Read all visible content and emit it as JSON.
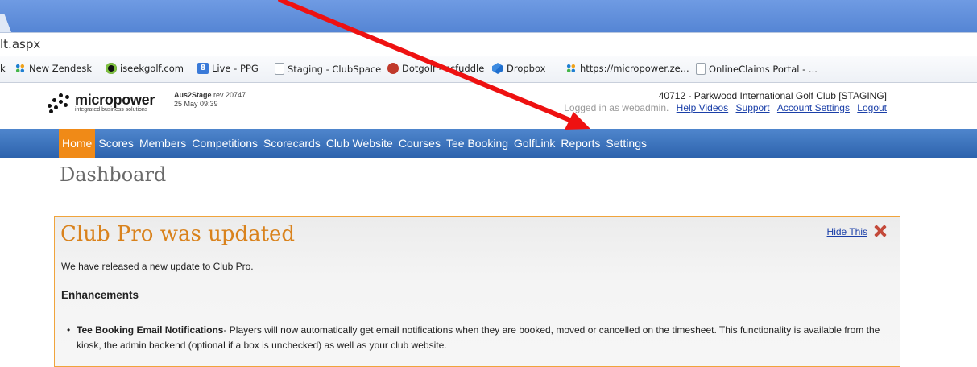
{
  "browser": {
    "url_partial": "lt.aspx",
    "bookmarks": [
      {
        "label": "k",
        "icon": "none"
      },
      {
        "label": "New Zendesk",
        "icon": "dots-icon"
      },
      {
        "label": "iseekgolf.com",
        "icon": "golfball-icon"
      },
      {
        "label": "Live - PPG",
        "icon": "google-icon"
      },
      {
        "label": "Staging - ClubSpace",
        "icon": "page-icon"
      },
      {
        "label": "Dotgolf - ccfuddle",
        "icon": "red-circle-icon"
      },
      {
        "label": "Dropbox",
        "icon": "dropbox-icon"
      },
      {
        "label": "https://micropower.ze...",
        "icon": "dots-icon"
      },
      {
        "label": "OnlineClaims Portal - ...",
        "icon": "page-icon"
      }
    ]
  },
  "header": {
    "logo_name": "micropower",
    "logo_tagline": "integrated business solutions",
    "server": "Aus2Stage",
    "revision": "rev 20747",
    "date": "25 May 09:39",
    "club": "40712 - Parkwood International Golf Club [STAGING]",
    "logged_in": "Logged in as webadmin.",
    "links": {
      "help": "Help Videos",
      "support": "Support",
      "account": "Account Settings",
      "logout": "Logout"
    }
  },
  "nav": {
    "items": [
      "Home",
      "Scores",
      "Members",
      "Competitions",
      "Scorecards",
      "Club Website",
      "Courses",
      "Tee Booking",
      "GolfLink",
      "Reports",
      "Settings"
    ],
    "active": "Home"
  },
  "page": {
    "title": "Dashboard"
  },
  "panel": {
    "title": "Club Pro was updated",
    "hide_label": "Hide This",
    "intro": "We have released a new update to Club Pro.",
    "heading": "Enhancements",
    "bullet_title": "Tee Booking Email Notifications",
    "bullet_text": "- Players will now automatically get email notifications when they are booked, moved or cancelled on the timesheet. This functionality is available from the kiosk, the admin backend (optional if a box is unchecked) as well as your club website."
  },
  "colors": {
    "nav": "#2d63ad",
    "nav_active": "#f08a17",
    "panel_title": "#d9821c",
    "annotation_arrow": "#ee1111"
  }
}
